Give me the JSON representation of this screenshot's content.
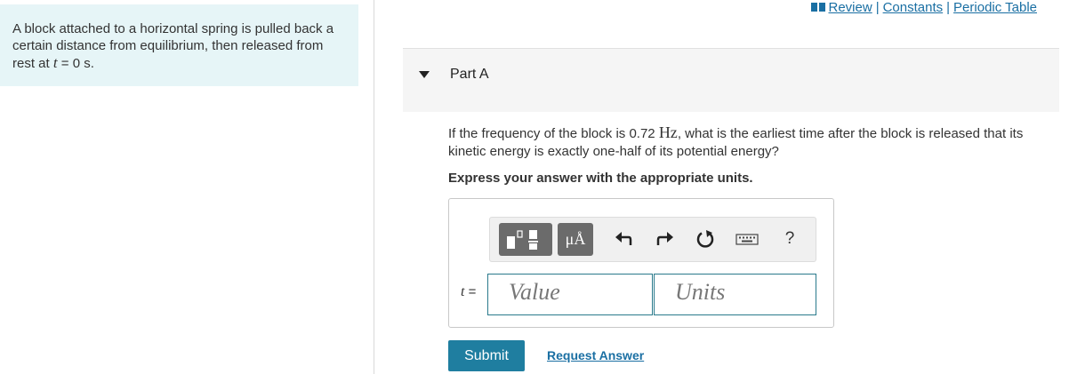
{
  "intro": {
    "text_before": "A block attached to a horizontal spring is pulled back a certain distance from equilibrium, then released from rest at ",
    "var": "t",
    "text_after": " = 0 s."
  },
  "links": {
    "review": "Review",
    "constants": "Constants",
    "periodic_table": "Periodic Table",
    "separator": "|"
  },
  "part": {
    "title": "Part A"
  },
  "question": {
    "before": "If the frequency of the block is 0.72 ",
    "unit": "Hz",
    "after": ", what is the earliest time after the block is released that its kinetic energy is exactly one-half of its potential energy?"
  },
  "instruction": "Express your answer with the appropriate units.",
  "toolbar": {
    "symbols_label": "μÅ",
    "help_label": "?",
    "icons": [
      "templates-icon",
      "symbols-icon",
      "undo-icon",
      "redo-icon",
      "reset-icon",
      "keyboard-icon",
      "help-icon"
    ]
  },
  "answer": {
    "var": "t",
    "eq": " =",
    "value_placeholder": "Value",
    "units_placeholder": "Units"
  },
  "actions": {
    "submit": "Submit",
    "request_answer": "Request Answer"
  },
  "colors": {
    "accent": "#1f7ea0",
    "link": "#1a6fa3",
    "intro_bg": "#e6f5f7"
  }
}
